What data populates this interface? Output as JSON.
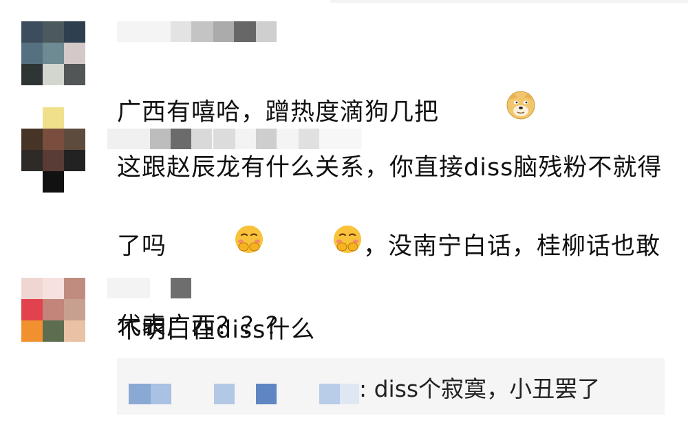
{
  "comments": [
    {
      "text": "广西有嘻哈，蹭热度滴狗几把",
      "emoji": "doge-emoji"
    },
    {
      "text_part1": "这跟赵辰龙有什么关系，你直接diss脑残粉不就得了吗",
      "text_part2": "，没南宁白话，桂柳话也敢代表广西？？？",
      "emoji": "smirk-covering-mouth-emoji"
    },
    {
      "text": "不明白在diss什么",
      "reply": {
        "text": ": diss个寂寞，小丑罢了"
      }
    }
  ],
  "colors": {
    "text": "#111111",
    "reply_background": "#f5f5f5"
  }
}
